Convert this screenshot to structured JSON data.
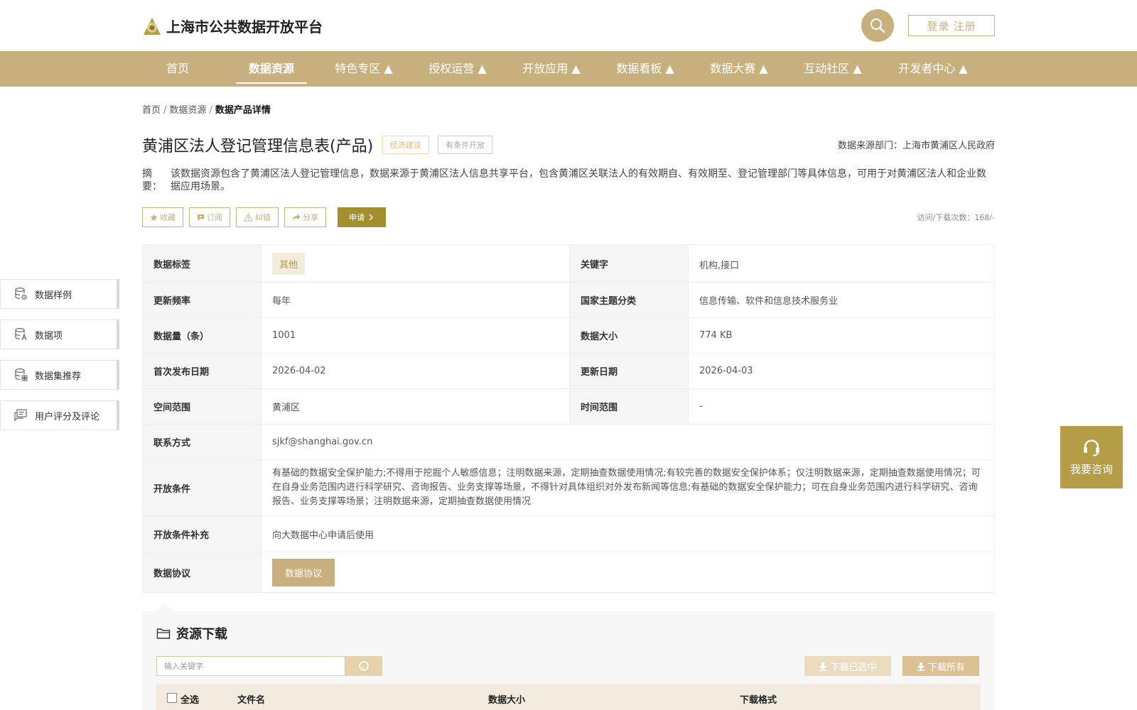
{
  "header": {
    "site_title": "上海市公共数据开放平台",
    "login_label": "登录 注册"
  },
  "nav": {
    "items": [
      "首页",
      "数据资源",
      "特色专区 ▲",
      "授权运营 ▲",
      "开放应用 ▲",
      "数据看板 ▲",
      "数据大赛 ▲",
      "互动社区 ▲",
      "开发者中心 ▲"
    ],
    "active_index": 1
  },
  "breadcrumb": {
    "home": "首页",
    "sep": "/",
    "section": "数据资源",
    "current": "数据产品详情"
  },
  "product": {
    "title": "黄浦区法人登记管理信息表(产品)",
    "tags": [
      "经济建设",
      "有条件开放"
    ],
    "source_dept": "数据来源部门：上海市黄浦区人民政府",
    "abstract_label": "摘 要：",
    "abstract": "该数据资源包含了黄浦区法人登记管理信息，数据来源于黄浦区法人信息共享平台，包含黄浦区关联法人的有效期自、有效期至、登记管理部门等具体信息，可用于对黄浦区法人和企业数据应用场景。",
    "visits": "访问/下载次数：168/-"
  },
  "actions": {
    "collect": "收藏",
    "subscribe": "订阅",
    "correct": "纠错",
    "share": "分享",
    "apply": "申请"
  },
  "info": {
    "tag_label": "数据标签",
    "tag_value": "其他",
    "keyword_label": "关键字",
    "keyword_value": "机构,接口",
    "freq_label": "更新频率",
    "freq_value": "每年",
    "category_label": "国家主题分类",
    "category_value": "信息传输、软件和信息技术服务业",
    "count_label": "数据量（条）",
    "count_value": "1001",
    "size_label": "数据大小",
    "size_value": "774 KB",
    "first_pub_label": "首次发布日期",
    "first_pub_value": "2026-04-02",
    "updated_label": "更新日期",
    "updated_value": "2026-04-03",
    "space_label": "空间范围",
    "space_value": "黄浦区",
    "time_label": "时间范围",
    "time_value": "-",
    "contact_label": "联系方式",
    "contact_value": "sjkf@shanghai.gov.cn",
    "cond_label": "开放条件",
    "cond_value": "有基础的数据安全保护能力;不得用于挖掘个人敏感信息；注明数据来源，定期抽查数据使用情况;有较完善的数据安全保护体系；仅注明数据来源，定期抽查数据使用情况；可在自身业务范围内进行科学研究、咨询报告、业务支撑等场景，不得针对具体组织对外发布新闻等信息;有基础的数据安全保护能力；可在自身业务范围内进行科学研究、咨询报告、业务支撑等场景；注明数据来源，定期抽查数据使用情况",
    "cond_extra_label": "开放条件补充",
    "cond_extra_value": "向大数据中心申请后使用",
    "protocol_label": "数据协议",
    "protocol_button": "数据协议"
  },
  "sidebar": {
    "items": [
      "数据样例",
      "数据项",
      "数据集推荐",
      "用户评分及评论"
    ]
  },
  "consult": {
    "label": "我要咨询"
  },
  "download": {
    "title": "资源下载",
    "search_placeholder": "输入关键字",
    "download_selected": "下载已选中",
    "download_all": "下载所有",
    "col_select_all": "全选",
    "col_filename": "文件名",
    "col_size": "数据大小",
    "col_format": "下载格式"
  },
  "colors": {
    "brand": "#c8b07e",
    "apply": "#a48f2e",
    "consult": "#b59d48"
  }
}
